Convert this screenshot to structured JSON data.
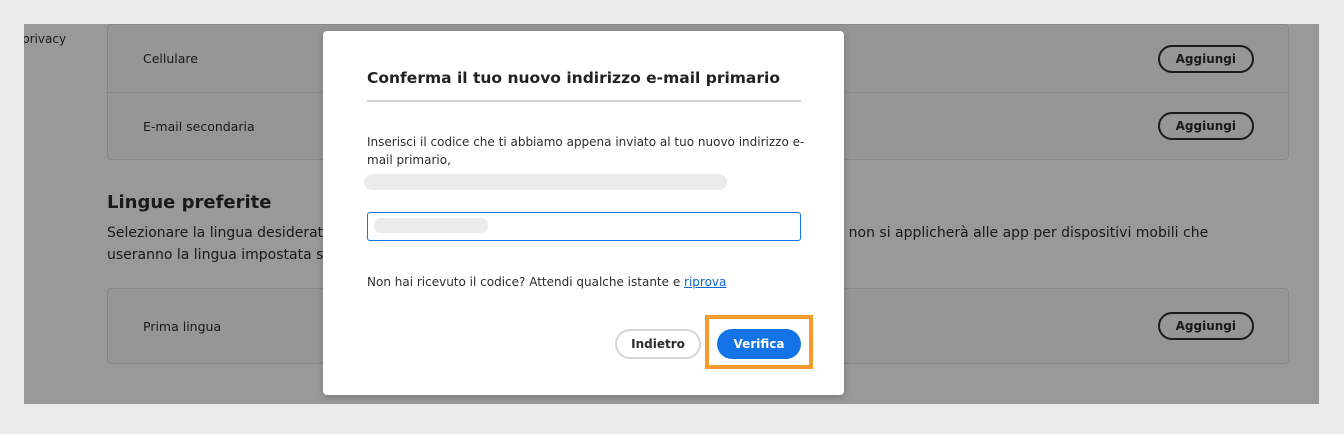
{
  "background": {
    "privacy_label": "privacy",
    "contact_rows": [
      {
        "label": "Cellulare",
        "button": "Aggiungi"
      },
      {
        "label": "E-mail secondaria",
        "button": "Aggiungi"
      }
    ],
    "languages": {
      "title": "Lingue preferite",
      "description_part1": "Selezionare la lingua desiderata",
      "description_part2": "he non si applicherà alle app per dispositivi mobili che",
      "description_line2": "useranno la lingua impostata su",
      "rows": [
        {
          "label": "Prima lingua",
          "button": "Aggiungi"
        }
      ]
    }
  },
  "dialog": {
    "title": "Conferma il tuo nuovo indirizzo e-mail primario",
    "instructions": "Inserisci il codice che ti abbiamo appena inviato al tuo nuovo indirizzo e-mail primario,",
    "resend_text": "Non hai ricevuto il codice? Attendi qualche istante e ",
    "resend_link": "riprova",
    "back_label": "Indietro",
    "verify_label": "Verifica"
  },
  "colors": {
    "accent": "#1473e6",
    "highlight": "#f39c2b",
    "link": "#0d66d0"
  }
}
